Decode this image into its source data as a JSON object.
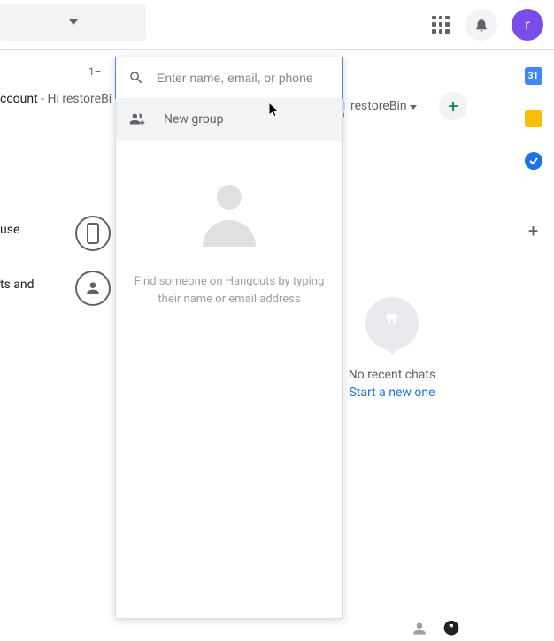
{
  "header": {
    "avatar_initial": "r"
  },
  "main": {
    "pagination": "1–",
    "email_subject": "ccount",
    "email_preview": " - Hi restoreBi",
    "left_text_1": "use",
    "left_text_2": "ts and"
  },
  "popup": {
    "search_placeholder": "Enter name, email, or phone",
    "new_group_label": "New group",
    "empty_text": "Find someone on Hangouts by typing their name or email address"
  },
  "hangouts": {
    "user_name": "restoreBin",
    "no_chats": "No recent chats",
    "start_new": "Start a new one"
  },
  "sidepanel": {
    "calendar_day": "31"
  }
}
